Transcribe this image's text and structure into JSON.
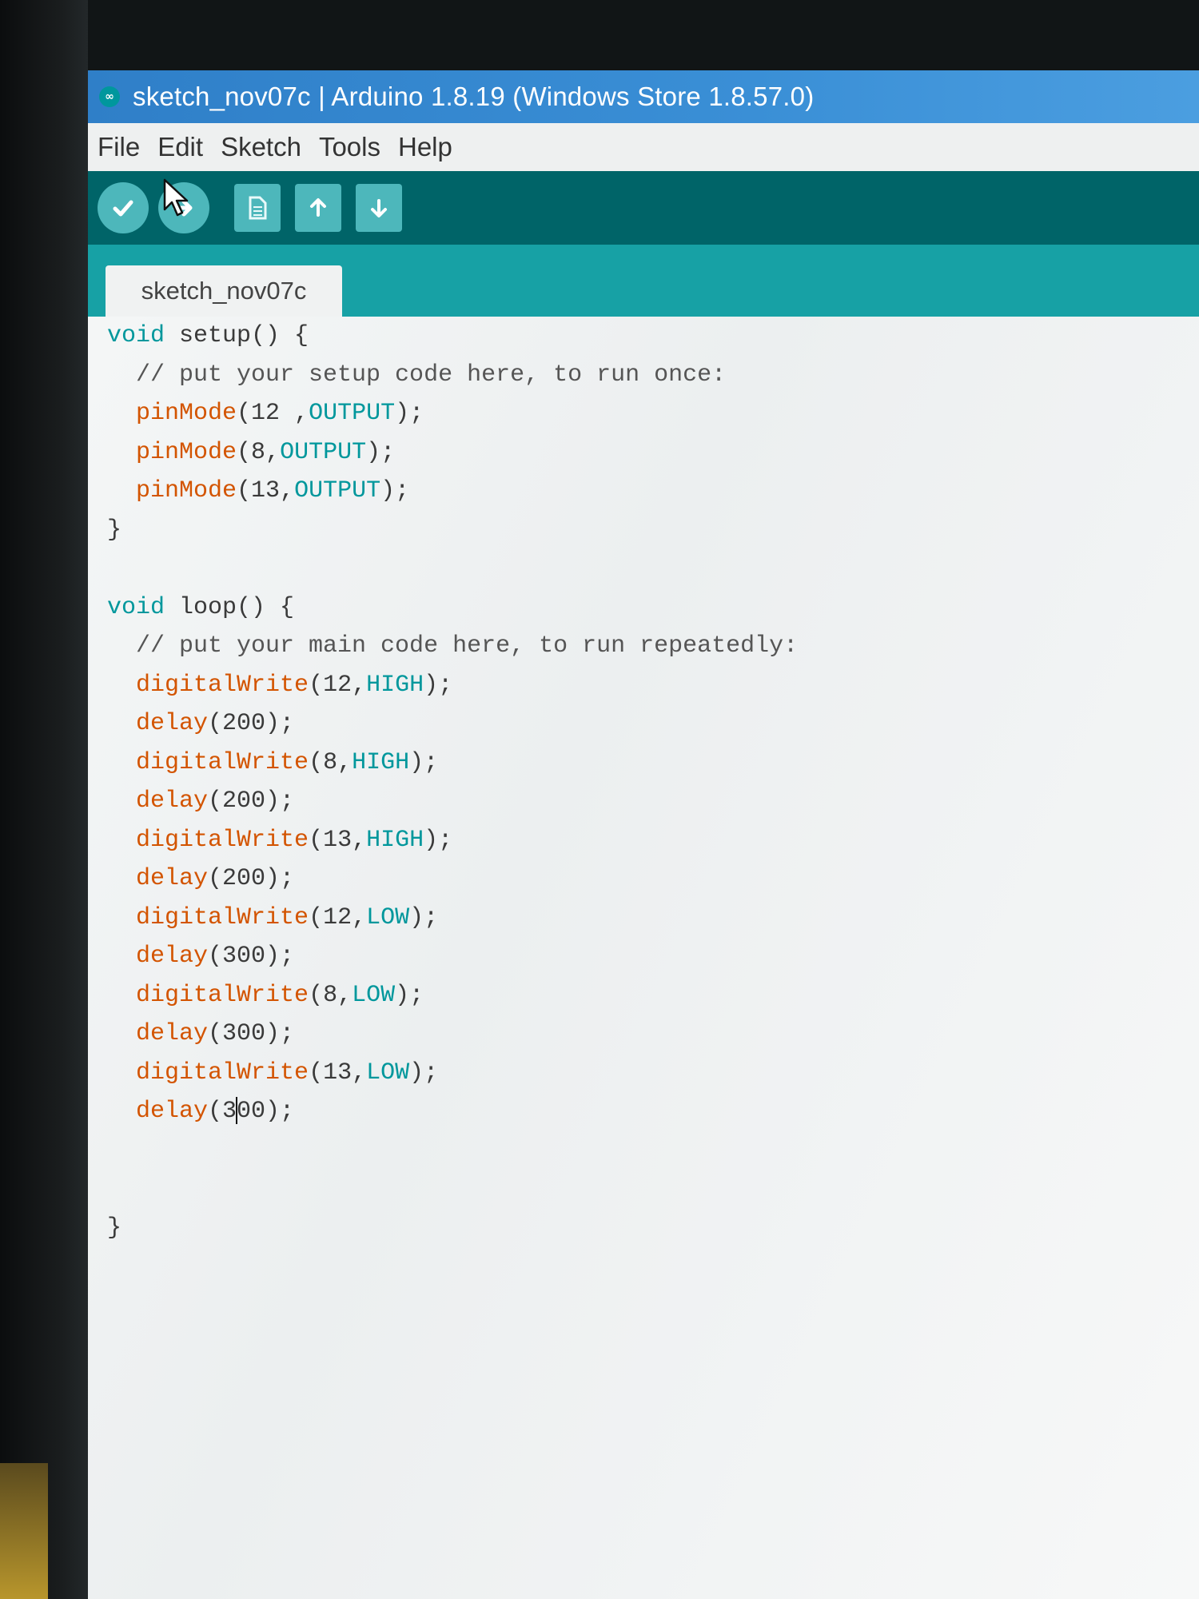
{
  "window": {
    "title": "sketch_nov07c | Arduino 1.8.19 (Windows Store 1.8.57.0)"
  },
  "menu": [
    "File",
    "Edit",
    "Sketch",
    "Tools",
    "Help"
  ],
  "toolbar": {
    "buttons": [
      {
        "name": "verify",
        "icon": "check-icon"
      },
      {
        "name": "upload",
        "icon": "arrow-right-icon"
      },
      {
        "name": "new",
        "icon": "document-icon"
      },
      {
        "name": "open",
        "icon": "arrow-up-icon"
      },
      {
        "name": "save",
        "icon": "arrow-down-icon"
      }
    ]
  },
  "tabs": [
    {
      "label": "sketch_nov07c",
      "active": true
    }
  ],
  "code": [
    {
      "segments": [
        {
          "t": "void",
          "c": "kw"
        },
        {
          "t": " setup() {",
          "c": ""
        }
      ]
    },
    {
      "segments": [
        {
          "t": "  // put your setup code here, to run once:",
          "c": "cmt"
        }
      ]
    },
    {
      "segments": [
        {
          "t": "  ",
          "c": ""
        },
        {
          "t": "pinMode",
          "c": "fn"
        },
        {
          "t": "(12 ,",
          "c": ""
        },
        {
          "t": "OUTPUT",
          "c": "cnst"
        },
        {
          "t": ");",
          "c": ""
        }
      ]
    },
    {
      "segments": [
        {
          "t": "  ",
          "c": ""
        },
        {
          "t": "pinMode",
          "c": "fn"
        },
        {
          "t": "(8,",
          "c": ""
        },
        {
          "t": "OUTPUT",
          "c": "cnst"
        },
        {
          "t": ");",
          "c": ""
        }
      ]
    },
    {
      "segments": [
        {
          "t": "  ",
          "c": ""
        },
        {
          "t": "pinMode",
          "c": "fn"
        },
        {
          "t": "(13,",
          "c": ""
        },
        {
          "t": "OUTPUT",
          "c": "cnst"
        },
        {
          "t": ");",
          "c": ""
        }
      ]
    },
    {
      "segments": [
        {
          "t": "}",
          "c": ""
        }
      ]
    },
    {
      "segments": [
        {
          "t": "",
          "c": ""
        }
      ]
    },
    {
      "segments": [
        {
          "t": "void",
          "c": "kw"
        },
        {
          "t": " loop() {",
          "c": ""
        }
      ]
    },
    {
      "segments": [
        {
          "t": "  // put your main code here, to run repeatedly:",
          "c": "cmt"
        }
      ]
    },
    {
      "segments": [
        {
          "t": "  ",
          "c": ""
        },
        {
          "t": "digitalWrite",
          "c": "fn"
        },
        {
          "t": "(12,",
          "c": ""
        },
        {
          "t": "HIGH",
          "c": "cnst"
        },
        {
          "t": ");",
          "c": ""
        }
      ]
    },
    {
      "segments": [
        {
          "t": "  ",
          "c": ""
        },
        {
          "t": "delay",
          "c": "fn"
        },
        {
          "t": "(200);",
          "c": ""
        }
      ]
    },
    {
      "segments": [
        {
          "t": "  ",
          "c": ""
        },
        {
          "t": "digitalWrite",
          "c": "fn"
        },
        {
          "t": "(8,",
          "c": ""
        },
        {
          "t": "HIGH",
          "c": "cnst"
        },
        {
          "t": ");",
          "c": ""
        }
      ]
    },
    {
      "segments": [
        {
          "t": "  ",
          "c": ""
        },
        {
          "t": "delay",
          "c": "fn"
        },
        {
          "t": "(200);",
          "c": ""
        }
      ]
    },
    {
      "segments": [
        {
          "t": "  ",
          "c": ""
        },
        {
          "t": "digitalWrite",
          "c": "fn"
        },
        {
          "t": "(13,",
          "c": ""
        },
        {
          "t": "HIGH",
          "c": "cnst"
        },
        {
          "t": ");",
          "c": ""
        }
      ]
    },
    {
      "segments": [
        {
          "t": "  ",
          "c": ""
        },
        {
          "t": "delay",
          "c": "fn"
        },
        {
          "t": "(200);",
          "c": ""
        }
      ]
    },
    {
      "segments": [
        {
          "t": "  ",
          "c": ""
        },
        {
          "t": "digitalWrite",
          "c": "fn"
        },
        {
          "t": "(12,",
          "c": ""
        },
        {
          "t": "LOW",
          "c": "cnst"
        },
        {
          "t": ");",
          "c": ""
        }
      ]
    },
    {
      "segments": [
        {
          "t": "  ",
          "c": ""
        },
        {
          "t": "delay",
          "c": "fn"
        },
        {
          "t": "(300);",
          "c": ""
        }
      ]
    },
    {
      "segments": [
        {
          "t": "  ",
          "c": ""
        },
        {
          "t": "digitalWrite",
          "c": "fn"
        },
        {
          "t": "(8,",
          "c": ""
        },
        {
          "t": "LOW",
          "c": "cnst"
        },
        {
          "t": ");",
          "c": ""
        }
      ]
    },
    {
      "segments": [
        {
          "t": "  ",
          "c": ""
        },
        {
          "t": "delay",
          "c": "fn"
        },
        {
          "t": "(300);",
          "c": ""
        }
      ]
    },
    {
      "segments": [
        {
          "t": "  ",
          "c": ""
        },
        {
          "t": "digitalWrite",
          "c": "fn"
        },
        {
          "t": "(13,",
          "c": ""
        },
        {
          "t": "LOW",
          "c": "cnst"
        },
        {
          "t": ");",
          "c": ""
        }
      ]
    },
    {
      "segments": [
        {
          "t": "  ",
          "c": ""
        },
        {
          "t": "delay",
          "c": "fn"
        },
        {
          "t": "(3",
          "c": ""
        },
        {
          "t": "|",
          "c": "cursor"
        },
        {
          "t": "00);",
          "c": ""
        }
      ]
    },
    {
      "segments": [
        {
          "t": "",
          "c": ""
        }
      ]
    },
    {
      "segments": [
        {
          "t": "",
          "c": ""
        }
      ]
    },
    {
      "segments": [
        {
          "t": "}",
          "c": ""
        }
      ]
    }
  ],
  "colors": {
    "titlebar": "#3a8fd6",
    "toolbar": "#006468",
    "tabstrip": "#17a1a5",
    "keyword": "#00979c",
    "function": "#d35400"
  }
}
